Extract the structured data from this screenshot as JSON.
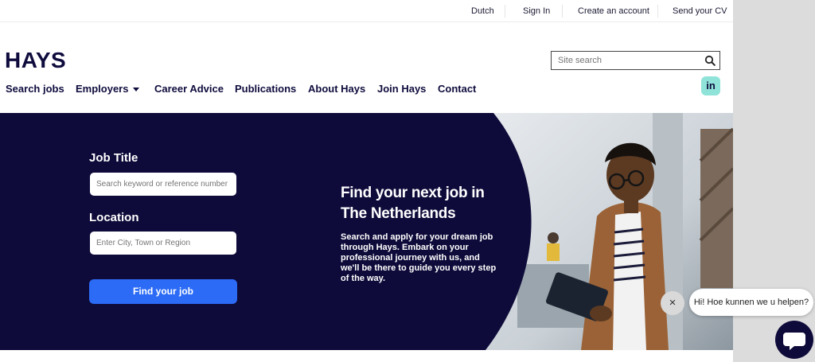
{
  "topbar": {
    "links": [
      "Dutch",
      "Sign In",
      "Create an account",
      "Send your CV"
    ]
  },
  "brand": {
    "logo_text": "HAYS",
    "color": "#0f0c3d"
  },
  "search": {
    "placeholder": "Site search",
    "icon": "search-icon"
  },
  "social": {
    "linkedin_label": "in",
    "icon": "linkedin-icon",
    "color": "#8fe3d9"
  },
  "nav": {
    "items": [
      "Search jobs",
      "Employers",
      "Career Advice",
      "Publications",
      "About Hays",
      "Join Hays",
      "Contact"
    ]
  },
  "hero": {
    "job_title_label": "Job Title",
    "job_title_placeholder": "Search keyword or reference number",
    "location_label": "Location",
    "location_placeholder": "Enter City, Town or Region",
    "cta_label": "Find your job",
    "headline": "Find your next job in The Netherlands",
    "subtext": "Search and apply for your dream job through Hays. Embark on your professional journey with us, and we'll be there to guide you every step of the way.",
    "background_color": "#0e0b3a",
    "cta_color": "#2b6bf6"
  },
  "chat": {
    "close_label": "×",
    "message": "Hi! Hoe kunnen we u helpen?",
    "icon": "chat-icon"
  }
}
